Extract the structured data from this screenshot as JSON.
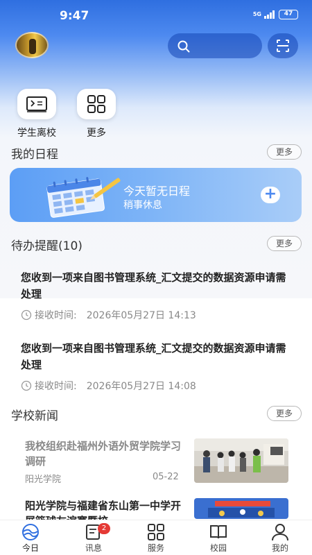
{
  "status_bar": {
    "time": "9:47",
    "network": "5G",
    "battery": "47"
  },
  "quick_actions": [
    {
      "label": "学生离校",
      "icon": "terminal-icon"
    },
    {
      "label": "更多",
      "icon": "grid-icon"
    }
  ],
  "schedule": {
    "title": "我的日程",
    "more": "更多",
    "empty_title": "今天暂无日程",
    "empty_sub": "稍事休息"
  },
  "todo": {
    "title": "待办提醒(10)",
    "more": "更多",
    "items": [
      {
        "text": "您收到一项来自图书管理系统_汇文提交的数据资源申请需处理",
        "time_label": "接收时间:",
        "time": "2026年05月27日 14:13"
      },
      {
        "text": "您收到一项来自图书管理系统_汇文提交的数据资源申请需处理",
        "time_label": "接收时间:",
        "time": "2026年05月27日 14:08"
      }
    ]
  },
  "news": {
    "title": "学校新闻",
    "more": "更多",
    "items": [
      {
        "title": "我校组织赴福州外语外贸学院学习调研",
        "source": "阳光学院",
        "date": "05-22"
      },
      {
        "title": "阳光学院与福建省东山第一中学开展篮球友谊赛暨校",
        "source": "",
        "date": ""
      }
    ]
  },
  "tabbar": {
    "items": [
      {
        "label": "今日",
        "icon": "today-logo-icon"
      },
      {
        "label": "讯息",
        "icon": "message-icon",
        "badge": "2"
      },
      {
        "label": "服务",
        "icon": "grid-icon"
      },
      {
        "label": "校园",
        "icon": "book-icon"
      },
      {
        "label": "我的",
        "icon": "user-icon"
      }
    ]
  },
  "colors": {
    "primary": "#2f6fe0",
    "accent_blue": "#4e8af0",
    "badge_red": "#e53935"
  }
}
